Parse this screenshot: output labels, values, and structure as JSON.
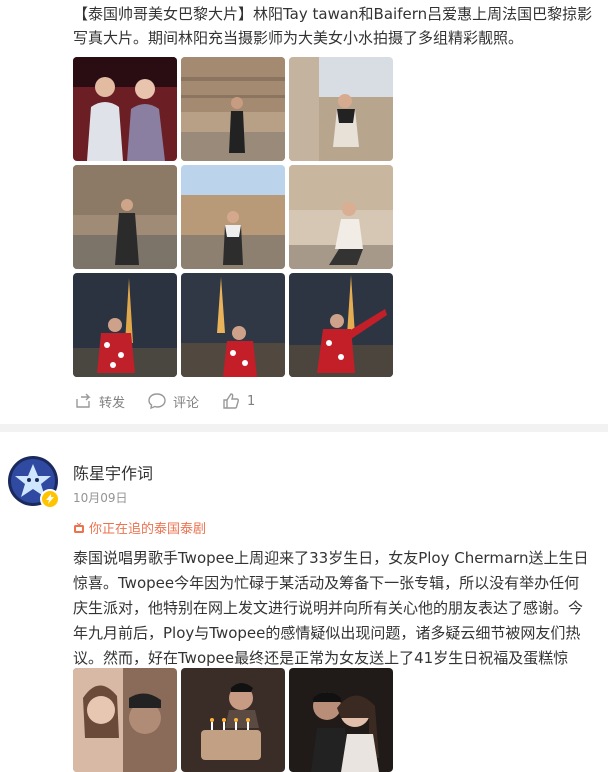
{
  "post1": {
    "text": "【泰国帅哥美女巴黎大片】林阳Tay tawan和Baifern吕爱惠上周法国巴黎掠影写真大片。期间林阳充当摄影师为大美女小水拍摄了多组精彩靓照。",
    "actions": {
      "repost_label": "转发",
      "comment_label": "评论",
      "like_count": "1"
    }
  },
  "post2": {
    "username": "陈星宇作词",
    "date": "10月09日",
    "topic": "你正在追的泰国泰剧",
    "text": "泰国说唱男歌手Twopee上周迎来了33岁生日，女友Ploy Chermarn送上生日惊喜。Twopee今年因为忙碌于某活动及筹备下一张专辑，所以没有举办任何庆生派对，他特别在网上发文进行说明并向所有关心他的朋友表达了感谢。今年九月前后，Ploy与Twopee的感情疑似出现问题，诸多疑云细节被网友们热议。然而，好在Twopee最终还是正常为女友送上了41岁生日祝福及蛋糕惊喜，解除疑云。"
  },
  "colors": {
    "accent": "#eb7350",
    "muted": "#808080",
    "badge": "#ffc300"
  }
}
